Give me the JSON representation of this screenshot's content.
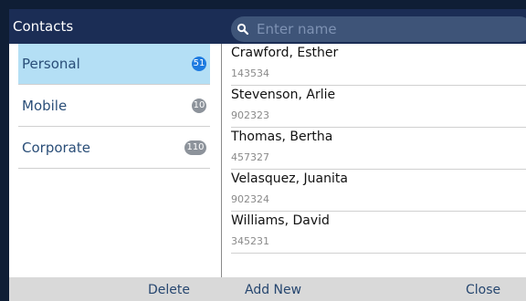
{
  "header": {
    "title": "Contacts",
    "search_placeholder": "Enter name"
  },
  "categories": [
    {
      "label": "Personal",
      "count": "51",
      "selected": true
    },
    {
      "label": "Mobile",
      "count": "10",
      "selected": false
    },
    {
      "label": "Corporate",
      "count": "110",
      "selected": false
    }
  ],
  "contacts": [
    {
      "name": "Crawford, Esther",
      "number": "143534"
    },
    {
      "name": "Stevenson, Arlie",
      "number": "902323"
    },
    {
      "name": "Thomas, Bertha",
      "number": "457327"
    },
    {
      "name": "Velasquez, Juanita",
      "number": "902324"
    },
    {
      "name": "Williams, David",
      "number": "345231"
    }
  ],
  "softkeys": {
    "delete": "Delete",
    "add_new": "Add New",
    "close": "Close"
  },
  "colors": {
    "header_bg": "#1b2d55",
    "selected_row": "#b4dff5",
    "badge_active": "#1e7be0",
    "badge_inactive": "#8d939b",
    "footer_bg": "#d9d9d9"
  }
}
